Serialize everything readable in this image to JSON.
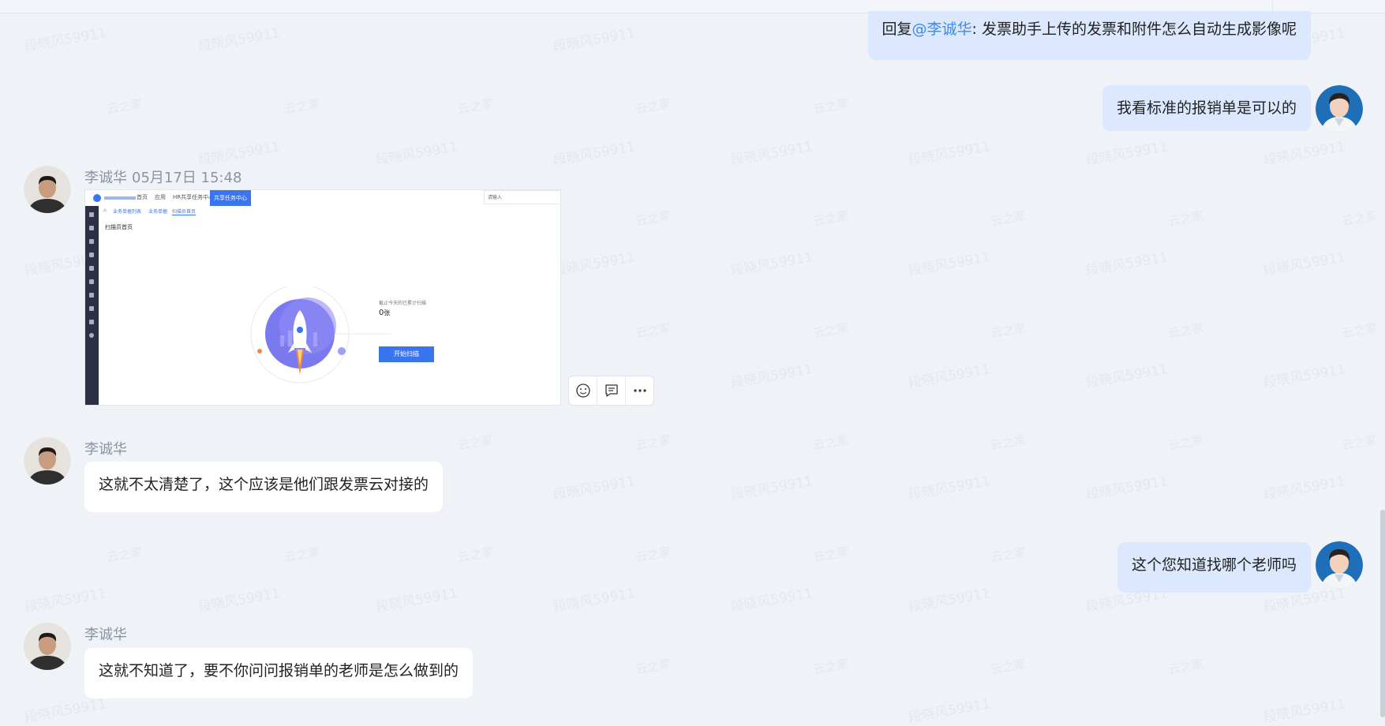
{
  "watermark": {
    "text_a": "段晓风59911",
    "text_b": "云之家"
  },
  "messages": [
    {
      "side": "right",
      "reply_prefix": "回复",
      "mention": "@李诚华",
      "text": ": 发票助手上传的发票和附件怎么自动生成影像呢"
    },
    {
      "side": "right",
      "text": "我看标准的报销单是可以的"
    },
    {
      "side": "left",
      "sender": "李诚华",
      "time": "05月17日 15:48",
      "type": "image",
      "screenshot": {
        "nav_tabs": [
          "首页",
          "应用",
          "HR共享任务中心",
          "共享任务中心"
        ],
        "search_placeholder": "请输入",
        "breadcrumb": [
          "业务单据列表",
          "业务单据",
          "扫描员首页"
        ],
        "page_title": "扫描员首页",
        "stat_label": "截止今天的已累计扫描",
        "stat_value": "0",
        "stat_unit": "张",
        "start_button": "开始扫描"
      }
    },
    {
      "side": "left",
      "sender": "李诚华",
      "text": "这就不太清楚了，这个应该是他们跟发票云对接的"
    },
    {
      "side": "right",
      "text": "这个您知道找哪个老师吗"
    },
    {
      "side": "left",
      "sender": "李诚华",
      "text": "这就不知道了，要不你问问报销单的老师是怎么做到的"
    }
  ],
  "actions": {
    "icons": [
      "emoji-icon",
      "comment-icon",
      "more-icon"
    ]
  },
  "colors": {
    "bg": "#eff3f8",
    "right_bubble": "#dbe8fd",
    "left_bubble": "#ffffff",
    "mention": "#3a8af0",
    "meta": "#8a94a3",
    "screenshot_accent": "#3a75f0"
  }
}
